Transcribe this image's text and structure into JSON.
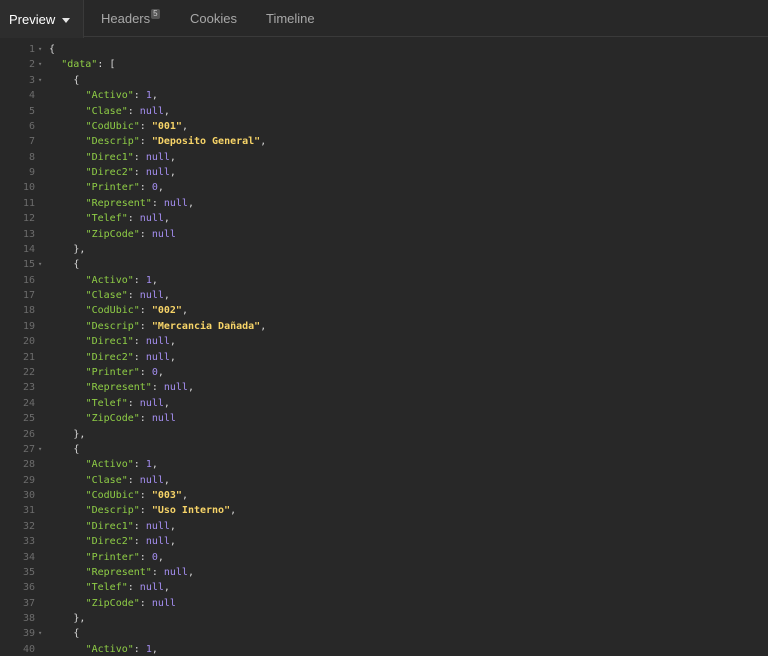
{
  "tabs": [
    {
      "label": "Preview",
      "active": true
    },
    {
      "label": "Headers",
      "badge": "5"
    },
    {
      "label": "Cookies"
    },
    {
      "label": "Timeline"
    }
  ],
  "icons": {
    "preview_dropdown": "caret-down-icon",
    "fold": "fold-arrow-icon"
  },
  "colors": {
    "background": "#282828",
    "key": "#8fce46",
    "string": "#f7d468",
    "number": "#a48ef0",
    "gutter": "#6c6c6c"
  },
  "lines": [
    {
      "n": "1",
      "fold": true,
      "indent": 0,
      "parts": [
        [
          "p",
          "{"
        ]
      ]
    },
    {
      "n": "2",
      "fold": true,
      "indent": 1,
      "parts": [
        [
          "k",
          "\"data\""
        ],
        [
          "p",
          ": ["
        ]
      ]
    },
    {
      "n": "3",
      "fold": true,
      "indent": 2,
      "parts": [
        [
          "p",
          "{"
        ]
      ]
    },
    {
      "n": "4",
      "indent": 3,
      "parts": [
        [
          "k",
          "\"Activo\""
        ],
        [
          "p",
          ": "
        ],
        [
          "n",
          "1"
        ],
        [
          "p",
          ","
        ]
      ]
    },
    {
      "n": "5",
      "indent": 3,
      "parts": [
        [
          "k",
          "\"Clase\""
        ],
        [
          "p",
          ": "
        ],
        [
          "n",
          "null"
        ],
        [
          "p",
          ","
        ]
      ]
    },
    {
      "n": "6",
      "indent": 3,
      "parts": [
        [
          "k",
          "\"CodUbic\""
        ],
        [
          "p",
          ": "
        ],
        [
          "s",
          "\"001\""
        ],
        [
          "p",
          ","
        ]
      ]
    },
    {
      "n": "7",
      "indent": 3,
      "parts": [
        [
          "k",
          "\"Descrip\""
        ],
        [
          "p",
          ": "
        ],
        [
          "s",
          "\"Deposito General\""
        ],
        [
          "p",
          ","
        ]
      ]
    },
    {
      "n": "8",
      "indent": 3,
      "parts": [
        [
          "k",
          "\"Direc1\""
        ],
        [
          "p",
          ": "
        ],
        [
          "n",
          "null"
        ],
        [
          "p",
          ","
        ]
      ]
    },
    {
      "n": "9",
      "indent": 3,
      "parts": [
        [
          "k",
          "\"Direc2\""
        ],
        [
          "p",
          ": "
        ],
        [
          "n",
          "null"
        ],
        [
          "p",
          ","
        ]
      ]
    },
    {
      "n": "10",
      "indent": 3,
      "parts": [
        [
          "k",
          "\"Printer\""
        ],
        [
          "p",
          ": "
        ],
        [
          "n",
          "0"
        ],
        [
          "p",
          ","
        ]
      ]
    },
    {
      "n": "11",
      "indent": 3,
      "parts": [
        [
          "k",
          "\"Represent\""
        ],
        [
          "p",
          ": "
        ],
        [
          "n",
          "null"
        ],
        [
          "p",
          ","
        ]
      ]
    },
    {
      "n": "12",
      "indent": 3,
      "parts": [
        [
          "k",
          "\"Telef\""
        ],
        [
          "p",
          ": "
        ],
        [
          "n",
          "null"
        ],
        [
          "p",
          ","
        ]
      ]
    },
    {
      "n": "13",
      "indent": 3,
      "parts": [
        [
          "k",
          "\"ZipCode\""
        ],
        [
          "p",
          ": "
        ],
        [
          "n",
          "null"
        ]
      ]
    },
    {
      "n": "14",
      "indent": 2,
      "parts": [
        [
          "p",
          "},"
        ]
      ]
    },
    {
      "n": "15",
      "fold": true,
      "indent": 2,
      "parts": [
        [
          "p",
          "{"
        ]
      ]
    },
    {
      "n": "16",
      "indent": 3,
      "parts": [
        [
          "k",
          "\"Activo\""
        ],
        [
          "p",
          ": "
        ],
        [
          "n",
          "1"
        ],
        [
          "p",
          ","
        ]
      ]
    },
    {
      "n": "17",
      "indent": 3,
      "parts": [
        [
          "k",
          "\"Clase\""
        ],
        [
          "p",
          ": "
        ],
        [
          "n",
          "null"
        ],
        [
          "p",
          ","
        ]
      ]
    },
    {
      "n": "18",
      "indent": 3,
      "parts": [
        [
          "k",
          "\"CodUbic\""
        ],
        [
          "p",
          ": "
        ],
        [
          "s",
          "\"002\""
        ],
        [
          "p",
          ","
        ]
      ]
    },
    {
      "n": "19",
      "indent": 3,
      "parts": [
        [
          "k",
          "\"Descrip\""
        ],
        [
          "p",
          ": "
        ],
        [
          "s",
          "\"Mercancia Dañada\""
        ],
        [
          "p",
          ","
        ]
      ]
    },
    {
      "n": "20",
      "indent": 3,
      "parts": [
        [
          "k",
          "\"Direc1\""
        ],
        [
          "p",
          ": "
        ],
        [
          "n",
          "null"
        ],
        [
          "p",
          ","
        ]
      ]
    },
    {
      "n": "21",
      "indent": 3,
      "parts": [
        [
          "k",
          "\"Direc2\""
        ],
        [
          "p",
          ": "
        ],
        [
          "n",
          "null"
        ],
        [
          "p",
          ","
        ]
      ]
    },
    {
      "n": "22",
      "indent": 3,
      "parts": [
        [
          "k",
          "\"Printer\""
        ],
        [
          "p",
          ": "
        ],
        [
          "n",
          "0"
        ],
        [
          "p",
          ","
        ]
      ]
    },
    {
      "n": "23",
      "indent": 3,
      "parts": [
        [
          "k",
          "\"Represent\""
        ],
        [
          "p",
          ": "
        ],
        [
          "n",
          "null"
        ],
        [
          "p",
          ","
        ]
      ]
    },
    {
      "n": "24",
      "indent": 3,
      "parts": [
        [
          "k",
          "\"Telef\""
        ],
        [
          "p",
          ": "
        ],
        [
          "n",
          "null"
        ],
        [
          "p",
          ","
        ]
      ]
    },
    {
      "n": "25",
      "indent": 3,
      "parts": [
        [
          "k",
          "\"ZipCode\""
        ],
        [
          "p",
          ": "
        ],
        [
          "n",
          "null"
        ]
      ]
    },
    {
      "n": "26",
      "indent": 2,
      "parts": [
        [
          "p",
          "},"
        ]
      ]
    },
    {
      "n": "27",
      "fold": true,
      "indent": 2,
      "parts": [
        [
          "p",
          "{"
        ]
      ]
    },
    {
      "n": "28",
      "indent": 3,
      "parts": [
        [
          "k",
          "\"Activo\""
        ],
        [
          "p",
          ": "
        ],
        [
          "n",
          "1"
        ],
        [
          "p",
          ","
        ]
      ]
    },
    {
      "n": "29",
      "indent": 3,
      "parts": [
        [
          "k",
          "\"Clase\""
        ],
        [
          "p",
          ": "
        ],
        [
          "n",
          "null"
        ],
        [
          "p",
          ","
        ]
      ]
    },
    {
      "n": "30",
      "indent": 3,
      "parts": [
        [
          "k",
          "\"CodUbic\""
        ],
        [
          "p",
          ": "
        ],
        [
          "s",
          "\"003\""
        ],
        [
          "p",
          ","
        ]
      ]
    },
    {
      "n": "31",
      "indent": 3,
      "parts": [
        [
          "k",
          "\"Descrip\""
        ],
        [
          "p",
          ": "
        ],
        [
          "s",
          "\"Uso Interno\""
        ],
        [
          "p",
          ","
        ]
      ]
    },
    {
      "n": "32",
      "indent": 3,
      "parts": [
        [
          "k",
          "\"Direc1\""
        ],
        [
          "p",
          ": "
        ],
        [
          "n",
          "null"
        ],
        [
          "p",
          ","
        ]
      ]
    },
    {
      "n": "33",
      "indent": 3,
      "parts": [
        [
          "k",
          "\"Direc2\""
        ],
        [
          "p",
          ": "
        ],
        [
          "n",
          "null"
        ],
        [
          "p",
          ","
        ]
      ]
    },
    {
      "n": "34",
      "indent": 3,
      "parts": [
        [
          "k",
          "\"Printer\""
        ],
        [
          "p",
          ": "
        ],
        [
          "n",
          "0"
        ],
        [
          "p",
          ","
        ]
      ]
    },
    {
      "n": "35",
      "indent": 3,
      "parts": [
        [
          "k",
          "\"Represent\""
        ],
        [
          "p",
          ": "
        ],
        [
          "n",
          "null"
        ],
        [
          "p",
          ","
        ]
      ]
    },
    {
      "n": "36",
      "indent": 3,
      "parts": [
        [
          "k",
          "\"Telef\""
        ],
        [
          "p",
          ": "
        ],
        [
          "n",
          "null"
        ],
        [
          "p",
          ","
        ]
      ]
    },
    {
      "n": "37",
      "indent": 3,
      "parts": [
        [
          "k",
          "\"ZipCode\""
        ],
        [
          "p",
          ": "
        ],
        [
          "n",
          "null"
        ]
      ]
    },
    {
      "n": "38",
      "indent": 2,
      "parts": [
        [
          "p",
          "},"
        ]
      ]
    },
    {
      "n": "39",
      "fold": true,
      "indent": 2,
      "parts": [
        [
          "p",
          "{"
        ]
      ]
    },
    {
      "n": "40",
      "indent": 3,
      "parts": [
        [
          "k",
          "\"Activo\""
        ],
        [
          "p",
          ": "
        ],
        [
          "n",
          "1"
        ],
        [
          "p",
          ","
        ]
      ]
    }
  ]
}
